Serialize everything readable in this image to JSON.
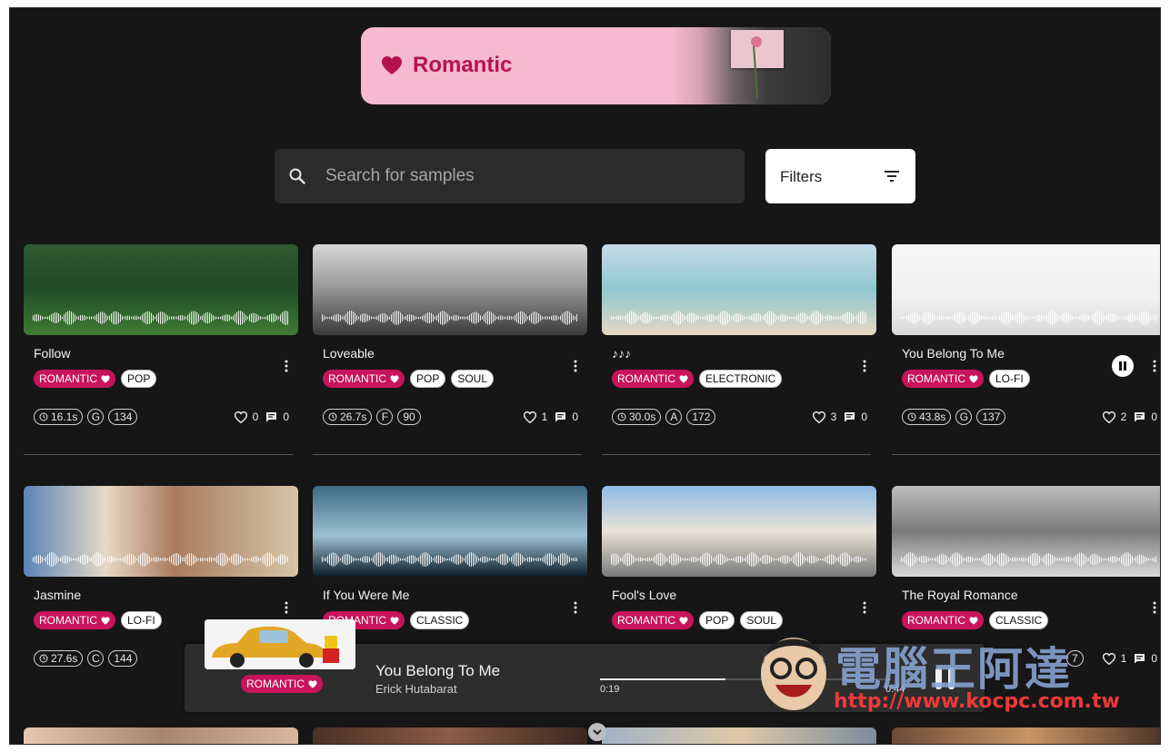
{
  "banner": {
    "title": "Romantic"
  },
  "search": {
    "placeholder": "Search for samples"
  },
  "filters": {
    "label": "Filters"
  },
  "cards": [
    {
      "title": "Follow",
      "tags": [
        "ROMANTIC",
        "POP"
      ],
      "duration": "16.1s",
      "key": "G",
      "bpm": "134",
      "likes": "0",
      "comments": "0"
    },
    {
      "title": "Loveable",
      "tags": [
        "ROMANTIC",
        "POP",
        "SOUL"
      ],
      "duration": "26.7s",
      "key": "F",
      "bpm": "90",
      "likes": "1",
      "comments": "0"
    },
    {
      "title": "♪♪♪",
      "tags": [
        "ROMANTIC",
        "ELECTRONIC"
      ],
      "duration": "30.0s",
      "key": "A",
      "bpm": "172",
      "likes": "3",
      "comments": "0"
    },
    {
      "title": "You Belong To Me",
      "tags": [
        "ROMANTIC",
        "LO-FI"
      ],
      "duration": "43.8s",
      "key": "G",
      "bpm": "137",
      "likes": "2",
      "comments": "0",
      "playing": true
    },
    {
      "title": "Jasmine",
      "tags": [
        "ROMANTIC",
        "LO-FI"
      ],
      "duration": "27.6s",
      "key": "C",
      "bpm": "144",
      "likes": "",
      "comments": ""
    },
    {
      "title": "If You Were Me",
      "tags": [
        "ROMANTIC",
        "CLASSIC"
      ],
      "duration": "",
      "key": "",
      "bpm": "",
      "likes": "",
      "comments": ""
    },
    {
      "title": "Fool's Love",
      "tags": [
        "ROMANTIC",
        "POP",
        "SOUL"
      ],
      "duration": "",
      "key": "",
      "bpm": "",
      "likes": "",
      "comments": ""
    },
    {
      "title": "The Royal Romance",
      "tags": [
        "ROMANTIC",
        "CLASSIC"
      ],
      "duration": "",
      "key": "",
      "bpm": "7",
      "likes": "1",
      "comments": "0"
    }
  ],
  "player": {
    "title": "You Belong To Me",
    "artist": "Erick Hutabarat",
    "tag": "ROMANTIC",
    "elapsed": "0:19",
    "total": "0:44",
    "progress_fraction": 0.43
  },
  "watermark": {
    "text": "電腦王阿達",
    "url": "http://www.kocpc.com.tw"
  },
  "colors": {
    "accent": "#c8145a",
    "background": "#161616",
    "banner": "#f6b9cf"
  },
  "icons": [
    "heart-icon",
    "search-icon",
    "filter-icon",
    "clock-icon",
    "comment-icon",
    "more-vertical-icon",
    "pause-icon",
    "chevron-down-icon"
  ]
}
